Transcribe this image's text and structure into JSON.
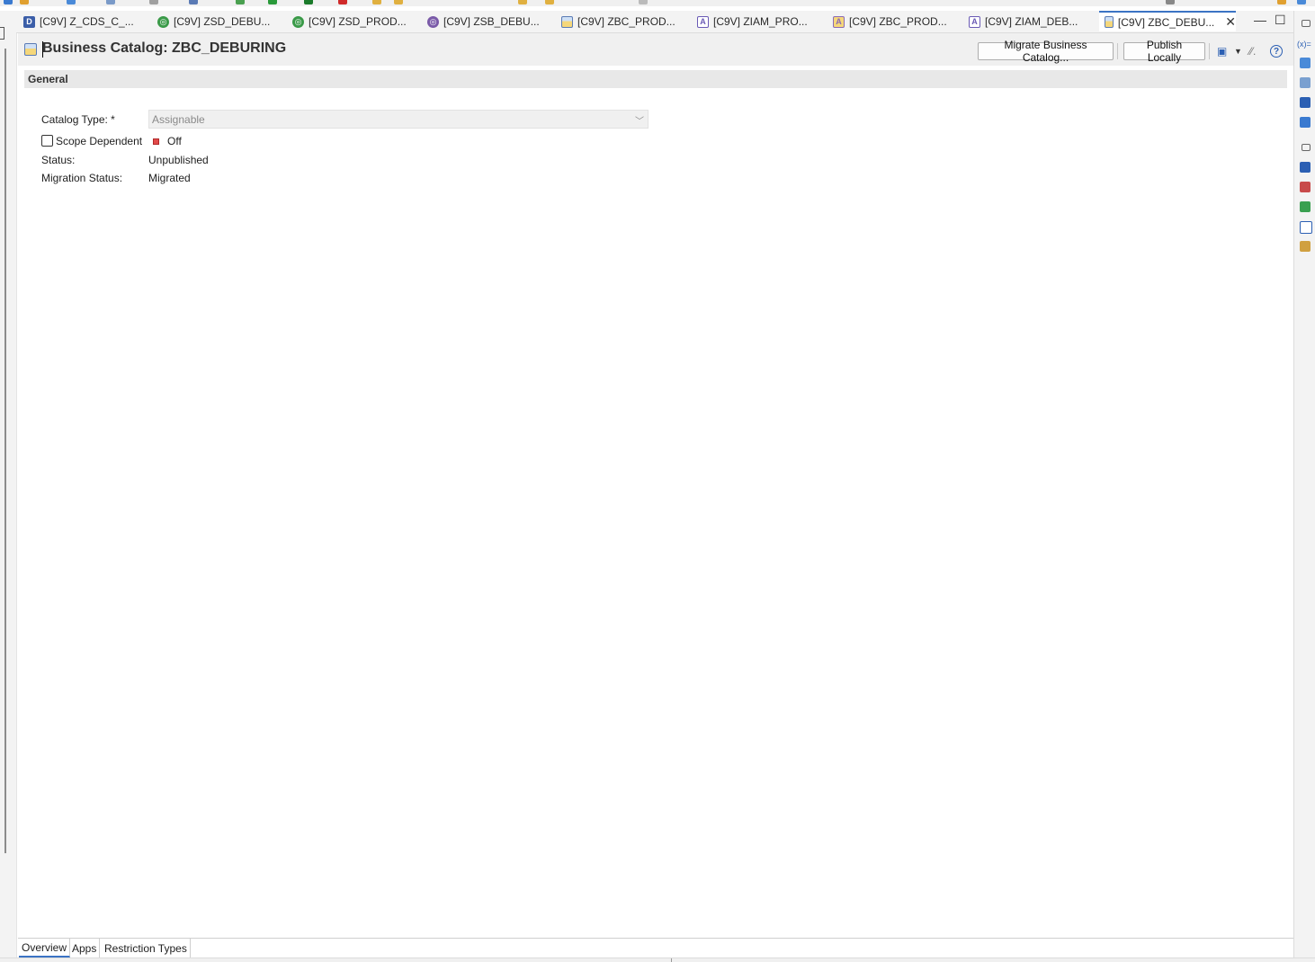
{
  "tabs": [
    {
      "label": "[C9V] Z_CDS_C_...",
      "icon": "ddl-icon",
      "icon_color": "#3b5ea8",
      "icon_letter": "D"
    },
    {
      "label": "[C9V] ZSD_DEBU...",
      "icon": "service-definition-icon",
      "icon_color": "#3a9a48",
      "icon_letter": "◎"
    },
    {
      "label": "[C9V] ZSD_PROD...",
      "icon": "service-definition-icon",
      "icon_color": "#3a9a48",
      "icon_letter": "◎"
    },
    {
      "label": "[C9V] ZSB_DEBU...",
      "icon": "service-binding-icon",
      "icon_color": "#7a5aa8",
      "icon_letter": "◎"
    },
    {
      "label": "[C9V] ZBC_PROD...",
      "icon": "business-catalog-icon",
      "icon_color": "#5a7bb5",
      "icon_letter": ""
    },
    {
      "label": "[C9V] ZIAM_PRO...",
      "icon": "iam-app-icon",
      "icon_color": "#6a5ab5",
      "icon_letter": "A"
    },
    {
      "label": "[C9V] ZBC_PROD...",
      "icon": "business-catalog-app-icon",
      "icon_color": "#8a6ab5",
      "icon_letter": "A"
    },
    {
      "label": "[C9V] ZIAM_DEB...",
      "icon": "iam-app-icon",
      "icon_color": "#6a5ab5",
      "icon_letter": "A"
    },
    {
      "label": "[C9V] ZBC_DEBU...",
      "icon": "business-catalog-icon",
      "icon_color": "#5a7bb5",
      "icon_letter": "",
      "active": true
    }
  ],
  "header": {
    "title": "Business Catalog: ZBC_DEBURING",
    "migrate_button": "Migrate Business Catalog...",
    "publish_button": "Publish Locally"
  },
  "section": {
    "title": "General"
  },
  "form": {
    "catalog_type_label": "Catalog Type: *",
    "catalog_type_value": "Assignable",
    "scope_dependent_label": "Scope Dependent",
    "scope_dependent_state": "Off",
    "status_label": "Status:",
    "status_value": "Unpublished",
    "migration_status_label": "Migration Status:",
    "migration_status_value": "Migrated"
  },
  "bottom_tabs": [
    {
      "label": "Overview",
      "active": true
    },
    {
      "label": "Apps"
    },
    {
      "label": "Restriction Types"
    }
  ],
  "colors": {
    "accent": "#3b73c4",
    "off_indicator": "#e24a4a"
  }
}
